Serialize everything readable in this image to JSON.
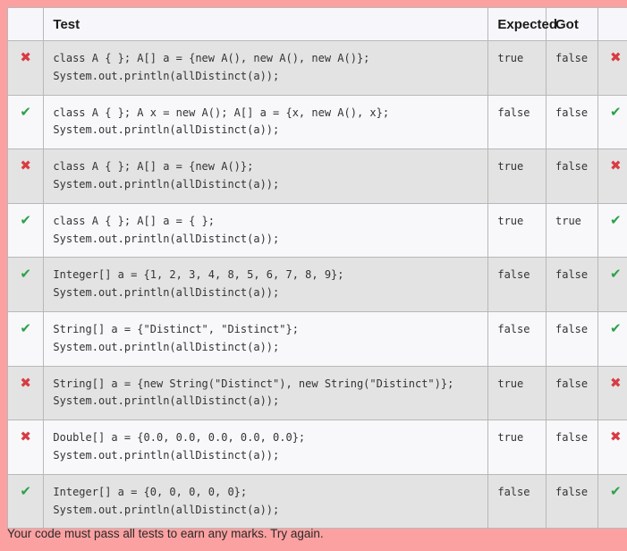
{
  "accent": {
    "page_background": "#fca1a1",
    "pass_color": "#2ca14a",
    "fail_color": "#d93b43",
    "header_background": "#f7f7fb",
    "row_odd_background": "#e3e3e3",
    "row_even_background": "#f8f8fb",
    "border_color": "#b8b8b8"
  },
  "table": {
    "columns": {
      "status": "",
      "test": "Test",
      "expected": "Expected",
      "got": "Got",
      "result": ""
    },
    "icons": {
      "pass": "✔",
      "fail": "✖"
    },
    "rows": [
      {
        "status": "fail",
        "code_line_1": "class A { }; A[] a = {new A(), new A(), new A()};",
        "code_line_2": "System.out.println(allDistinct(a));",
        "expected": "true",
        "got": "false",
        "result": "fail"
      },
      {
        "status": "pass",
        "code_line_1": "class A { }; A x = new A(); A[] a = {x, new A(), x};",
        "code_line_2": "System.out.println(allDistinct(a));",
        "expected": "false",
        "got": "false",
        "result": "pass"
      },
      {
        "status": "fail",
        "code_line_1": "class A { }; A[] a = {new A()};",
        "code_line_2": "System.out.println(allDistinct(a));",
        "expected": "true",
        "got": "false",
        "result": "fail"
      },
      {
        "status": "pass",
        "code_line_1": "class A { }; A[] a = { };",
        "code_line_2": "System.out.println(allDistinct(a));",
        "expected": "true",
        "got": "true",
        "result": "pass"
      },
      {
        "status": "pass",
        "code_line_1": "Integer[] a = {1, 2, 3, 4, 8, 5, 6, 7, 8, 9};",
        "code_line_2": "System.out.println(allDistinct(a));",
        "expected": "false",
        "got": "false",
        "result": "pass"
      },
      {
        "status": "pass",
        "code_line_1": "String[] a = {\"Distinct\", \"Distinct\"};",
        "code_line_2": "System.out.println(allDistinct(a));",
        "expected": "false",
        "got": "false",
        "result": "pass"
      },
      {
        "status": "fail",
        "code_line_1": "String[] a = {new String(\"Distinct\"), new String(\"Distinct\")};",
        "code_line_2": "System.out.println(allDistinct(a));",
        "expected": "true",
        "got": "false",
        "result": "fail"
      },
      {
        "status": "fail",
        "code_line_1": "Double[] a = {0.0, 0.0, 0.0, 0.0, 0.0};",
        "code_line_2": "System.out.println(allDistinct(a));",
        "expected": "true",
        "got": "false",
        "result": "fail"
      },
      {
        "status": "pass",
        "code_line_1": "Integer[] a = {0, 0, 0, 0, 0};",
        "code_line_2": "System.out.println(allDistinct(a));",
        "expected": "false",
        "got": "false",
        "result": "pass"
      }
    ]
  },
  "footer": {
    "message": "Your code must pass all tests to earn any marks. Try again."
  }
}
